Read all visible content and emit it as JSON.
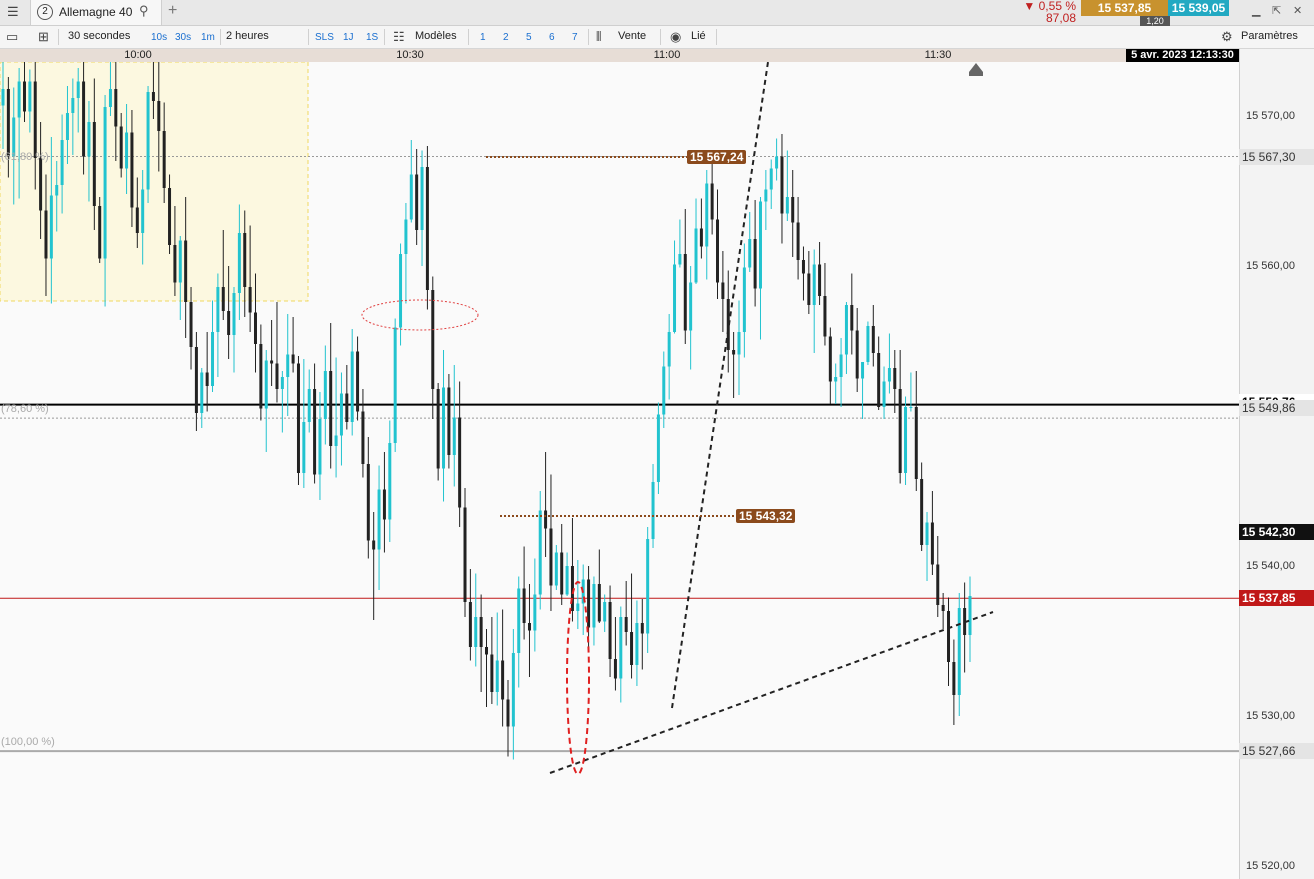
{
  "tabbar": {
    "menu_icon": "hamburger-icon",
    "tab_number": "2",
    "tab_name": "Allemagne 40",
    "search_icon": "search-icon",
    "add_icon": "plus-icon",
    "change_pct": "▼ 0,55 %",
    "change_abs": "87,08",
    "sell_price": "15 537,85",
    "buy_price": "15 539,05",
    "spread": "1,20",
    "colors": {
      "sell": "#c8922e",
      "buy": "#22a9c2",
      "down": "#c02020"
    }
  },
  "toolbar": {
    "interval": "30 secondes",
    "intervals": [
      "10s",
      "30s",
      "1m"
    ],
    "period": "2 heures",
    "ranges": [
      "SLS",
      "1J",
      "1S"
    ],
    "templates_label": "Modèles",
    "numbers": [
      "1",
      "2",
      "5",
      "6",
      "7"
    ],
    "sell_label": "Vente",
    "linked_label": "Lié",
    "settings_label": "Paramètres"
  },
  "chart_data": {
    "type": "candlestick",
    "time_ticks": [
      "10:00",
      "10:30",
      "11:00",
      "11:30"
    ],
    "datetime": "5 avr. 2023 12:13:30",
    "price_ticks": [
      "15 570,00",
      "15 560,00",
      "15 540,00",
      "15 530,00",
      "15 520,00"
    ],
    "ylim": [
      15519,
      15573
    ],
    "colors": {
      "up": "#22c3cf",
      "down": "#222222"
    },
    "levels": [
      {
        "label": "15 567,30",
        "price": 15567.3,
        "fib": "(61,80 %)"
      },
      {
        "label": "15 549,86",
        "price": 15549.86,
        "fib": "(78,60 %)"
      },
      {
        "label": "15 527,66",
        "price": 15527.66,
        "fib": "(100,00 %)"
      }
    ],
    "black_line": {
      "label": "15 550,76",
      "price": 15550.76
    },
    "current_price": {
      "label": "15 537,85",
      "price": 15537.85
    },
    "last_marker": {
      "label": "15 542,30",
      "price": 15542.3
    },
    "annotations": [
      {
        "label": "15 567,24",
        "price": 15567.24
      },
      {
        "label": "15 543,32",
        "price": 15543.32
      }
    ],
    "candles": [
      [
        15570.7,
        15573.9,
        15567.8,
        15571.8
      ],
      [
        15571.8,
        15572.6,
        15565.9,
        15567.3
      ],
      [
        15567.3,
        15571.9,
        15564.1,
        15569.9
      ],
      [
        15569.9,
        15573.2,
        15564.5,
        15572.3
      ],
      [
        15572.3,
        15575.2,
        15569.6,
        15570.3
      ],
      [
        15570.3,
        15573.1,
        15568.9,
        15572.3
      ],
      [
        15572.3,
        15575.5,
        15565.1,
        15567.2
      ],
      [
        15567.2,
        15569.6,
        15561.8,
        15563.7
      ],
      [
        15563.7,
        15566.1,
        15558.0,
        15560.5
      ],
      [
        15560.5,
        15568.6,
        15557.5,
        15564.7
      ],
      [
        15564.7,
        15567.0,
        15562.3,
        15565.4
      ],
      [
        15565.4,
        15570.1,
        15563.5,
        15568.4
      ],
      [
        15568.4,
        15572.0,
        15566.8,
        15570.2
      ],
      [
        15570.2,
        15572.5,
        15567.4,
        15571.2
      ],
      [
        15571.2,
        15573.2,
        15568.9,
        15572.3
      ],
      [
        15572.3,
        15575.4,
        15566.1,
        15567.3
      ],
      [
        15567.3,
        15571.0,
        15564.3,
        15569.6
      ],
      [
        15569.6,
        15572.5,
        15562.4,
        15564.0
      ],
      [
        15564.0,
        15564.6,
        15560.2,
        15560.5
      ],
      [
        15560.5,
        15571.4,
        15557.3,
        15570.6
      ],
      [
        15570.6,
        15575.3,
        15570.0,
        15571.8
      ],
      [
        15571.8,
        15576.1,
        15567.0,
        15569.3
      ],
      [
        15569.3,
        15570.2,
        15565.9,
        15566.5
      ],
      [
        15566.5,
        15570.8,
        15564.8,
        15568.9
      ],
      [
        15568.9,
        15570.4,
        15562.6,
        15563.9
      ],
      [
        15563.9,
        15565.9,
        15561.2,
        15562.2
      ],
      [
        15562.2,
        15566.4,
        15560.1,
        15565.1
      ],
      [
        15565.1,
        15572.0,
        15564.2,
        15571.6
      ],
      [
        15571.6,
        15573.7,
        15569.8,
        15571.0
      ],
      [
        15571.0,
        15574.5,
        15566.3,
        15569.0
      ],
      [
        15569.0,
        15570.9,
        15564.2,
        15565.2
      ],
      [
        15565.2,
        15566.1,
        15560.8,
        15561.4
      ],
      [
        15561.4,
        15564.0,
        15558.0,
        15558.9
      ],
      [
        15558.9,
        15562.0,
        15556.4,
        15561.7
      ],
      [
        15561.7,
        15564.6,
        15555.2,
        15557.6
      ],
      [
        15557.6,
        15558.6,
        15553.1,
        15554.6
      ],
      [
        15554.6,
        15555.6,
        15549.0,
        15550.2
      ],
      [
        15550.2,
        15553.2,
        15549.2,
        15552.9
      ],
      [
        15552.9,
        15555.6,
        15550.3,
        15552.0
      ],
      [
        15552.0,
        15557.7,
        15551.6,
        15555.6
      ],
      [
        15555.6,
        15559.5,
        15552.6,
        15558.6
      ],
      [
        15558.6,
        15562.4,
        15556.4,
        15557.0
      ],
      [
        15557.0,
        15560.0,
        15553.8,
        15555.4
      ],
      [
        15555.4,
        15558.6,
        15552.9,
        15558.2
      ],
      [
        15558.2,
        15564.1,
        15556.4,
        15562.2
      ],
      [
        15562.2,
        15563.7,
        15556.6,
        15558.6
      ],
      [
        15558.6,
        15562.7,
        15555.6,
        15556.9
      ],
      [
        15556.9,
        15559.5,
        15552.9,
        15554.8
      ],
      [
        15554.8,
        15556.1,
        15549.7,
        15550.5
      ],
      [
        15550.5,
        15554.4,
        15547.6,
        15553.7
      ],
      [
        15553.7,
        15556.4,
        15552.0,
        15553.5
      ],
      [
        15553.5,
        15557.6,
        15550.9,
        15551.8
      ],
      [
        15551.8,
        15553.0,
        15548.9,
        15552.6
      ],
      [
        15552.6,
        15556.8,
        15550.0,
        15554.1
      ],
      [
        15554.1,
        15556.6,
        15552.9,
        15553.5
      ],
      [
        15553.5,
        15554.0,
        15545.4,
        15546.2
      ],
      [
        15546.2,
        15553.8,
        15545.2,
        15549.6
      ],
      [
        15549.6,
        15553.1,
        15548.9,
        15551.8
      ],
      [
        15551.8,
        15553.5,
        15545.5,
        15546.1
      ],
      [
        15546.1,
        15551.6,
        15544.4,
        15549.8
      ],
      [
        15549.8,
        15554.7,
        15548.1,
        15553.0
      ],
      [
        15553.0,
        15556.2,
        15546.5,
        15548.0
      ],
      [
        15548.0,
        15553.9,
        15545.9,
        15548.7
      ],
      [
        15548.7,
        15552.9,
        15546.7,
        15551.5
      ],
      [
        15551.5,
        15553.4,
        15549.1,
        15549.6
      ],
      [
        15549.6,
        15555.8,
        15548.7,
        15554.3
      ],
      [
        15554.3,
        15555.3,
        15549.7,
        15550.3
      ],
      [
        15550.3,
        15551.8,
        15545.9,
        15546.8
      ],
      [
        15546.8,
        15548.6,
        15540.5,
        15541.7
      ],
      [
        15541.7,
        15543.6,
        15536.4,
        15541.1
      ],
      [
        15541.1,
        15546.7,
        15538.4,
        15545.1
      ],
      [
        15545.1,
        15547.6,
        15540.9,
        15543.1
      ],
      [
        15543.1,
        15549.7,
        15541.6,
        15548.2
      ],
      [
        15548.2,
        15556.5,
        15547.6,
        15555.9
      ],
      [
        15555.9,
        15561.5,
        15554.7,
        15560.8
      ],
      [
        15560.8,
        15564.2,
        15557.5,
        15563.1
      ],
      [
        15563.1,
        15568.4,
        15562.9,
        15566.1
      ],
      [
        15566.1,
        15567.8,
        15561.4,
        15562.4
      ],
      [
        15562.4,
        15567.7,
        15560.0,
        15566.6
      ],
      [
        15566.6,
        15568.0,
        15557.1,
        15558.4
      ],
      [
        15558.4,
        15559.3,
        15549.8,
        15551.8
      ],
      [
        15551.8,
        15552.2,
        15545.7,
        15546.5
      ],
      [
        15546.5,
        15554.4,
        15544.3,
        15551.9
      ],
      [
        15551.9,
        15552.8,
        15546.5,
        15547.4
      ],
      [
        15547.4,
        15553.4,
        15545.3,
        15549.9
      ],
      [
        15549.9,
        15552.3,
        15542.6,
        15543.9
      ],
      [
        15543.9,
        15545.2,
        15536.6,
        15537.6
      ],
      [
        15537.6,
        15539.8,
        15533.7,
        15534.6
      ],
      [
        15534.6,
        15539.5,
        15533.3,
        15536.6
      ],
      [
        15536.6,
        15538.1,
        15531.6,
        15534.6
      ],
      [
        15534.6,
        15535.8,
        15530.6,
        15534.1
      ],
      [
        15534.1,
        15536.6,
        15530.8,
        15531.6
      ],
      [
        15531.6,
        15536.9,
        15530.7,
        15533.7
      ],
      [
        15533.7,
        15537.1,
        15529.3,
        15531.1
      ],
      [
        15531.1,
        15532.4,
        15527.3,
        15529.3
      ],
      [
        15529.3,
        15535.8,
        15527.1,
        15534.2
      ],
      [
        15534.2,
        15539.3,
        15531.9,
        15538.5
      ],
      [
        15538.5,
        15541.3,
        15535.1,
        15536.2
      ],
      [
        15536.2,
        15538.8,
        15532.6,
        15535.7
      ],
      [
        15535.7,
        15540.5,
        15534.3,
        15538.1
      ],
      [
        15538.1,
        15545.0,
        15537.1,
        15543.7
      ],
      [
        15543.7,
        15547.6,
        15540.6,
        15542.5
      ],
      [
        15542.5,
        15546.1,
        15537.0,
        15538.7
      ],
      [
        15538.7,
        15541.4,
        15538.4,
        15540.9
      ],
      [
        15540.9,
        15542.8,
        15537.4,
        15538.1
      ],
      [
        15538.1,
        15540.9,
        15538.0,
        15540.0
      ],
      [
        15540.0,
        15543.2,
        15536.3,
        15537.0
      ],
      [
        15537.0,
        15540.4,
        15535.8,
        15537.5
      ],
      [
        15537.5,
        15540.1,
        15535.4,
        15539.1
      ],
      [
        15539.1,
        15540.0,
        15534.3,
        15535.9
      ],
      [
        15535.9,
        15539.3,
        15534.7,
        15538.8
      ],
      [
        15538.8,
        15541.1,
        15536.2,
        15536.3
      ],
      [
        15536.3,
        15538.1,
        15535.6,
        15537.6
      ],
      [
        15537.6,
        15538.7,
        15532.6,
        15533.8
      ],
      [
        15533.8,
        15536.6,
        15531.7,
        15532.5
      ],
      [
        15532.5,
        15537.3,
        15530.9,
        15536.6
      ],
      [
        15536.6,
        15539.0,
        15534.7,
        15535.6
      ],
      [
        15535.6,
        15539.5,
        15532.5,
        15533.4
      ],
      [
        15533.4,
        15537.7,
        15532.0,
        15536.2
      ],
      [
        15536.2,
        15537.8,
        15533.1,
        15535.5
      ],
      [
        15535.5,
        15542.6,
        15534.2,
        15541.8
      ],
      [
        15541.8,
        15546.8,
        15541.2,
        15545.6
      ],
      [
        15545.6,
        15550.9,
        15544.8,
        15550.1
      ],
      [
        15550.1,
        15554.3,
        15549.2,
        15553.3
      ],
      [
        15553.3,
        15556.8,
        15551.1,
        15555.6
      ],
      [
        15555.6,
        15561.7,
        15555.5,
        15560.1
      ],
      [
        15560.1,
        15563.1,
        15559.9,
        15560.8
      ],
      [
        15560.8,
        15563.8,
        15554.8,
        15555.7
      ],
      [
        15555.7,
        15560.0,
        15553.1,
        15558.9
      ],
      [
        15558.9,
        15564.5,
        15558.8,
        15562.5
      ],
      [
        15562.5,
        15564.5,
        15560.5,
        15561.3
      ],
      [
        15561.3,
        15566.4,
        15559.1,
        15565.5
      ],
      [
        15565.5,
        15567.6,
        15562.1,
        15563.1
      ],
      [
        15563.1,
        15565.1,
        15557.8,
        15558.9
      ],
      [
        15558.9,
        15561.0,
        15555.6,
        15557.8
      ],
      [
        15557.8,
        15559.7,
        15552.9,
        15554.4
      ],
      [
        15554.4,
        15555.6,
        15551.2,
        15554.1
      ],
      [
        15554.1,
        15557.7,
        15551.4,
        15555.6
      ],
      [
        15555.6,
        15561.5,
        15553.9,
        15559.9
      ],
      [
        15559.9,
        15563.6,
        15559.6,
        15561.8
      ],
      [
        15561.8,
        15564.4,
        15557.3,
        15558.5
      ],
      [
        15558.5,
        15564.6,
        15555.1,
        15564.3
      ],
      [
        15564.3,
        15566.4,
        15562.4,
        15565.1
      ],
      [
        15565.1,
        15567.1,
        15563.8,
        15566.5
      ],
      [
        15566.5,
        15568.5,
        15565.7,
        15567.3
      ],
      [
        15567.3,
        15568.8,
        15561.5,
        15563.5
      ],
      [
        15563.5,
        15567.7,
        15563.0,
        15564.6
      ],
      [
        15564.6,
        15566.4,
        15560.6,
        15562.9
      ],
      [
        15562.9,
        15564.6,
        15559.1,
        15560.4
      ],
      [
        15560.4,
        15561.3,
        15557.7,
        15559.5
      ],
      [
        15559.5,
        15561.0,
        15556.8,
        15557.4
      ],
      [
        15557.4,
        15561.1,
        15554.2,
        15560.1
      ],
      [
        15560.1,
        15561.6,
        15557.4,
        15558.0
      ],
      [
        15558.0,
        15560.2,
        15554.7,
        15555.3
      ],
      [
        15555.3,
        15555.9,
        15550.8,
        15552.3
      ],
      [
        15552.3,
        15553.5,
        15550.8,
        15552.6
      ],
      [
        15552.6,
        15555.2,
        15550.6,
        15554.1
      ],
      [
        15554.1,
        15557.6,
        15552.8,
        15557.4
      ],
      [
        15557.4,
        15559.5,
        15554.1,
        15555.7
      ],
      [
        15555.7,
        15557.2,
        15551.6,
        15552.5
      ],
      [
        15552.5,
        15553.6,
        15549.8,
        15553.6
      ],
      [
        15553.6,
        15556.3,
        15553.4,
        15556.0
      ],
      [
        15556.0,
        15557.4,
        15553.3,
        15554.2
      ],
      [
        15554.2,
        15555.3,
        15550.4,
        15550.6
      ],
      [
        15550.6,
        15553.3,
        15549.8,
        15552.3
      ],
      [
        15552.3,
        15555.5,
        15551.5,
        15553.2
      ],
      [
        15553.2,
        15554.4,
        15550.2,
        15551.8
      ],
      [
        15551.8,
        15554.4,
        15545.5,
        15546.2
      ],
      [
        15546.2,
        15551.3,
        15545.4,
        15550.6
      ],
      [
        15550.6,
        15552.9,
        15550.3,
        15550.6
      ],
      [
        15550.6,
        15553.0,
        15545.0,
        15545.8
      ],
      [
        15545.8,
        15546.9,
        15541.0,
        15541.4
      ],
      [
        15541.4,
        15543.6,
        15539.0,
        15542.9
      ],
      [
        15542.9,
        15545.0,
        15539.4,
        15540.1
      ],
      [
        15540.1,
        15542.0,
        15536.6,
        15537.4
      ],
      [
        15537.4,
        15538.2,
        15535.8,
        15537.0
      ],
      [
        15537.0,
        15537.9,
        15532.0,
        15533.6
      ],
      [
        15533.6,
        15535.1,
        15529.4,
        15531.4
      ],
      [
        15531.4,
        15538.2,
        15530.0,
        15537.2
      ],
      [
        15537.2,
        15538.9,
        15532.9,
        15535.4
      ],
      [
        15535.4,
        15539.3,
        15533.6,
        15538.0
      ]
    ]
  }
}
